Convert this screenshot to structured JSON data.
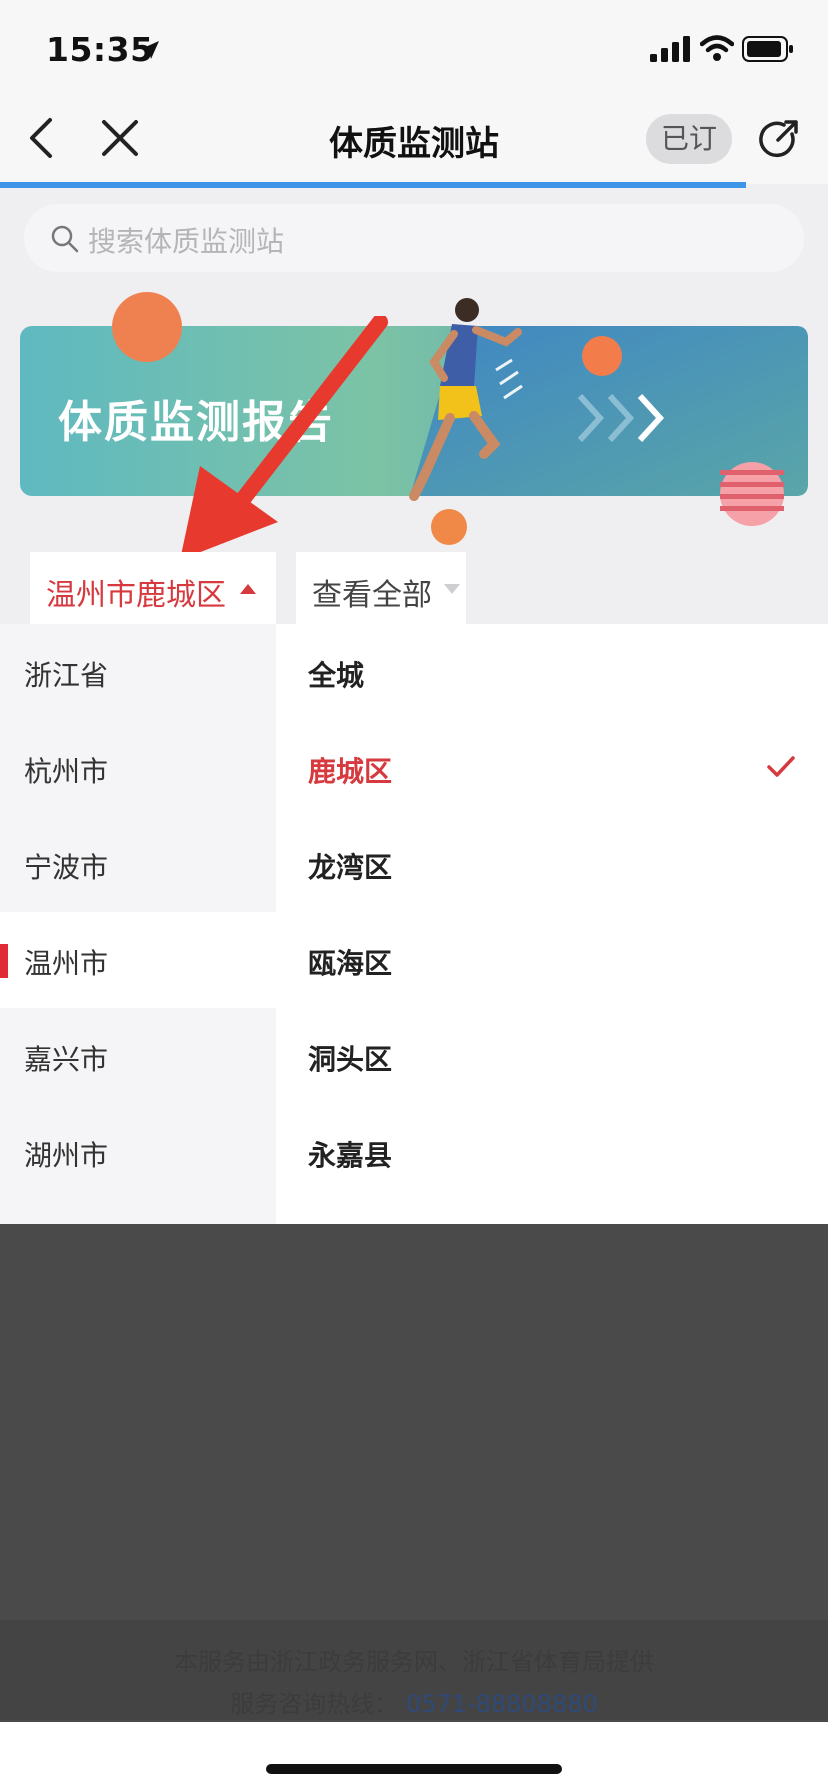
{
  "status_bar": {
    "time": "15:35"
  },
  "nav": {
    "title": "体质监测站",
    "subscribe_label": "已订"
  },
  "search": {
    "placeholder": "搜索体质监测站"
  },
  "banner": {
    "title": "体质监测报告"
  },
  "filters": {
    "region_label": "温州市鹿城区",
    "scope_label": "查看全部"
  },
  "cities": [
    {
      "label": "浙江省",
      "active": false
    },
    {
      "label": "杭州市",
      "active": false
    },
    {
      "label": "宁波市",
      "active": false
    },
    {
      "label": "温州市",
      "active": true
    },
    {
      "label": "嘉兴市",
      "active": false
    },
    {
      "label": "湖州市",
      "active": false
    }
  ],
  "districts": [
    {
      "label": "全城",
      "selected": false
    },
    {
      "label": "鹿城区",
      "selected": true
    },
    {
      "label": "龙湾区",
      "selected": false
    },
    {
      "label": "瓯海区",
      "selected": false
    },
    {
      "label": "洞头区",
      "selected": false
    },
    {
      "label": "永嘉县",
      "selected": false
    }
  ],
  "footer": {
    "line1": "本服务由浙江政务服务网、浙江省体育局提供",
    "hotline_label": "服务咨询热线：",
    "hotline_number": "0571-88808880"
  },
  "colors": {
    "accent_red": "#d63a3f",
    "progress_blue": "#3e94e6",
    "overlay": "#4a4a4a"
  }
}
